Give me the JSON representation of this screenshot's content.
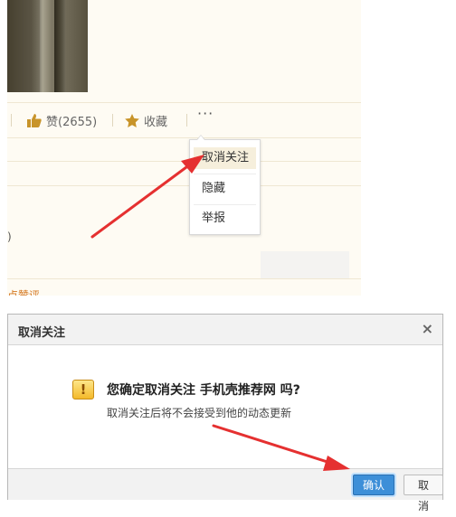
{
  "actions": {
    "like_label": "赞(2655)",
    "favorite_label": "收藏",
    "more_label": "···"
  },
  "dropdown": {
    "items": [
      "取消关注",
      "隐藏",
      "举报"
    ]
  },
  "fragments": {
    "paren": ")",
    "bottom_link": "点赞评"
  },
  "dialog": {
    "title": "取消关注",
    "close": "×",
    "question": "您确定取消关注 手机壳推荐网 吗?",
    "note": "取消关注后将不会接受到他的动态更新",
    "warning_glyph": "!",
    "ok_label": "确认",
    "cancel_label": "取消"
  },
  "colors": {
    "accent_gold": "#c8942a",
    "annotation_arrow": "#e53030",
    "ok_button": "#3d8fd8"
  }
}
